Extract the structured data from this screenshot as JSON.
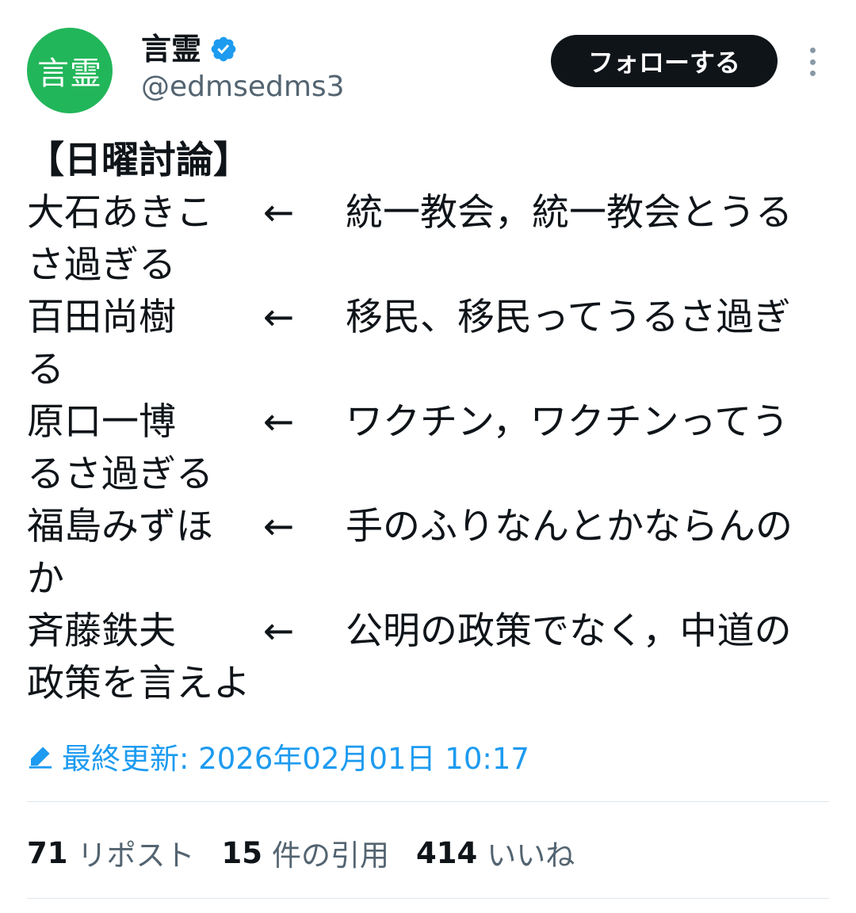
{
  "header": {
    "avatar_text": "言霊",
    "display_name": "言霊",
    "handle": "@edmsedms3",
    "follow_label": "フォローする",
    "verified_icon": "verified-badge-icon",
    "accent_color": "#1d9bf0",
    "avatar_color": "#22b65a"
  },
  "tweet": {
    "title": "【日曜討論】",
    "entries": [
      {
        "name": "大石あきこ",
        "arrow": "←",
        "text1": "統一教会，統一教会とうる",
        "text2": "さ過ぎる"
      },
      {
        "name": "百田尚樹",
        "arrow": "←",
        "text1": "移民、移民ってうるさ過ぎ",
        "text2": "る"
      },
      {
        "name": "原口一博",
        "arrow": "←",
        "text1": "ワクチン，ワクチンってう",
        "text2": "るさ過ぎる"
      },
      {
        "name": "福島みずほ",
        "arrow": "←",
        "text1": "手のふりなんとかならんの",
        "text2": "か"
      },
      {
        "name": "斉藤鉄夫",
        "arrow": "←",
        "text1": "公明の政策でなく，中道の",
        "text2": "政策を言えよ"
      }
    ]
  },
  "updated": {
    "text": "最終更新: 2026年02月01日 10:17",
    "icon": "pencil-icon"
  },
  "stats": [
    {
      "count": "71",
      "label": "リポスト"
    },
    {
      "count": "15",
      "label": "件の引用"
    },
    {
      "count": "414",
      "label": "いいね"
    }
  ]
}
